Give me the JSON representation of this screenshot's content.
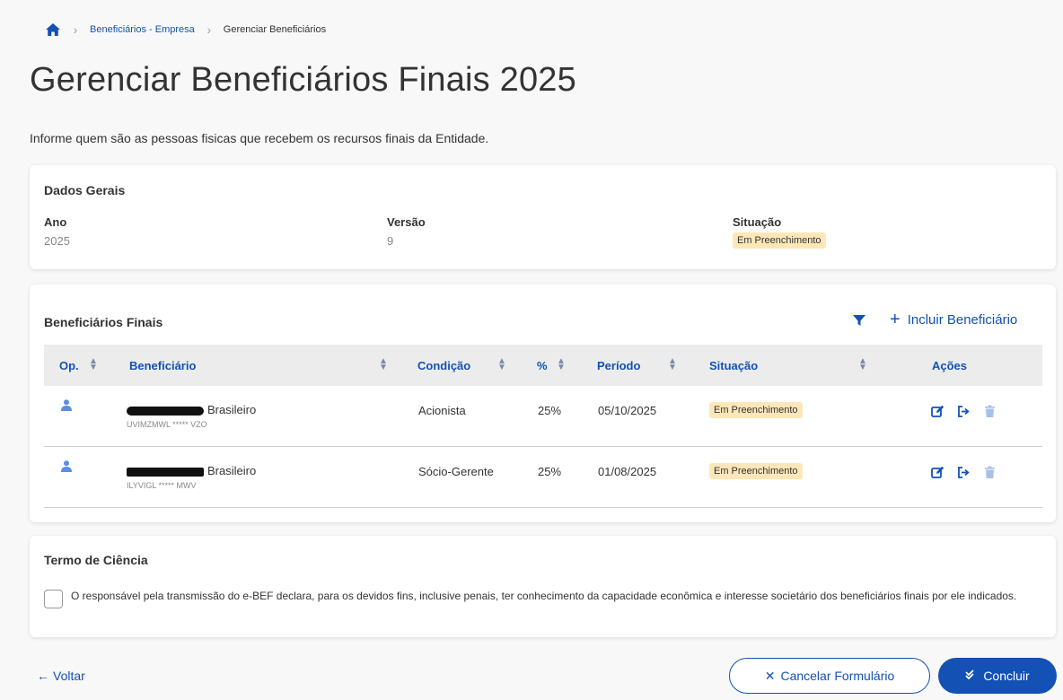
{
  "breadcrumb": {
    "home_icon": "home-icon",
    "items": [
      "Beneficiários - Empresa",
      "Gerenciar Beneficiários"
    ]
  },
  "page": {
    "title": "Gerenciar Beneficiários Finais 2025",
    "description": "Informe quem são as pessoas fisicas que recebem os recursos finais da Entidade."
  },
  "dados_gerais": {
    "title": "Dados Gerais",
    "ano_label": "Ano",
    "ano_value": "2025",
    "versao_label": "Versão",
    "versao_value": "9",
    "situacao_label": "Situação",
    "situacao_value": "Em Preenchimento"
  },
  "beneficiarios": {
    "title": "Beneficiários Finais",
    "add_label": "Incluir Beneficiário",
    "columns": {
      "op": "Op.",
      "beneficiario": "Beneficiário",
      "condicao": "Condição",
      "pct": "%",
      "periodo": "Período",
      "situacao": "Situação",
      "acoes": "Ações"
    },
    "rows": [
      {
        "nacionalidade": "Brasileiro",
        "nome": "UVIMZMWL ***** VZO",
        "condicao": "Acionista",
        "pct": "25%",
        "periodo": "05/10/2025",
        "situacao": "Em Preenchimento"
      },
      {
        "nacionalidade": "Brasileiro",
        "nome": "ILYVIGL ***** MWV",
        "condicao": "Sócio-Gerente",
        "pct": "25%",
        "periodo": "01/08/2025",
        "situacao": "Em Preenchimento"
      }
    ]
  },
  "termo": {
    "title": "Termo de Ciência",
    "text": "O responsável pela transmissão do e-BEF declara, para os devidos fins, inclusive penais, ter conhecimento da capacidade econômica e interesse societário dos beneficiários finais por ele indicados."
  },
  "footer": {
    "voltar": "Voltar",
    "cancel": "Cancelar Formulário",
    "concluir": "Concluir"
  },
  "colors": {
    "primary": "#1351b4",
    "badge_bg": "#fde7b8",
    "header_bg": "#ececec"
  }
}
